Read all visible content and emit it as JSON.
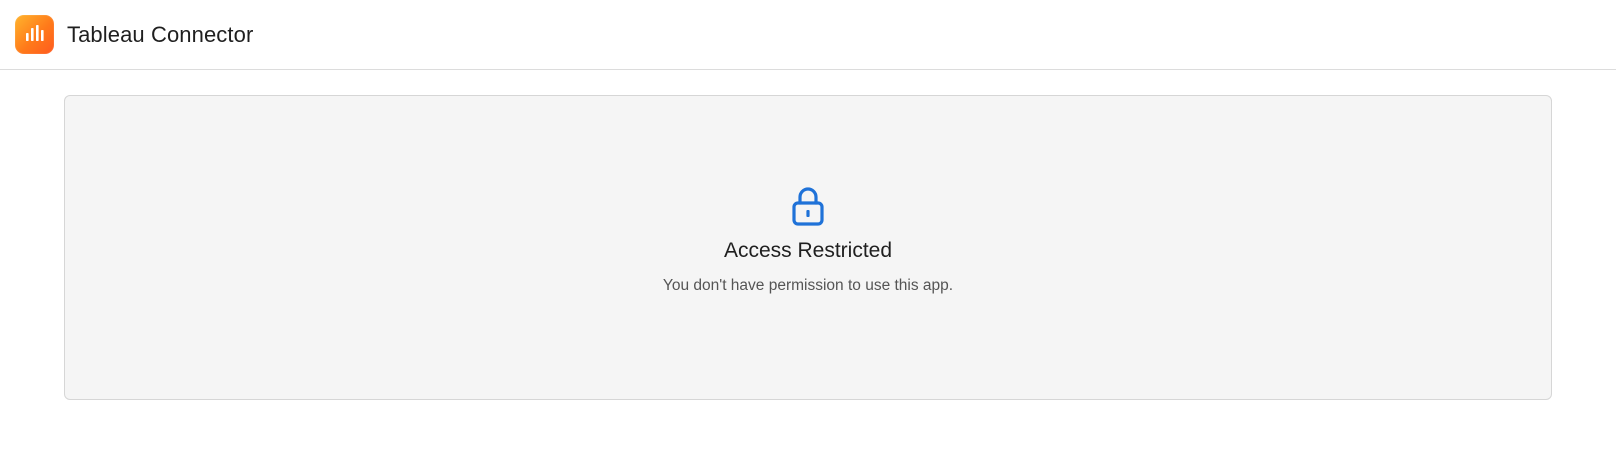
{
  "header": {
    "app_title": "Tableau Connector",
    "logo_icon": "bar-chart-icon",
    "logo_gradient_start": "#ffb42d",
    "logo_gradient_end": "#ff5a1f"
  },
  "message_card": {
    "icon": "lock-icon",
    "icon_color": "#1f72d8",
    "title": "Access Restricted",
    "message": "You don't have permission to use this app."
  }
}
